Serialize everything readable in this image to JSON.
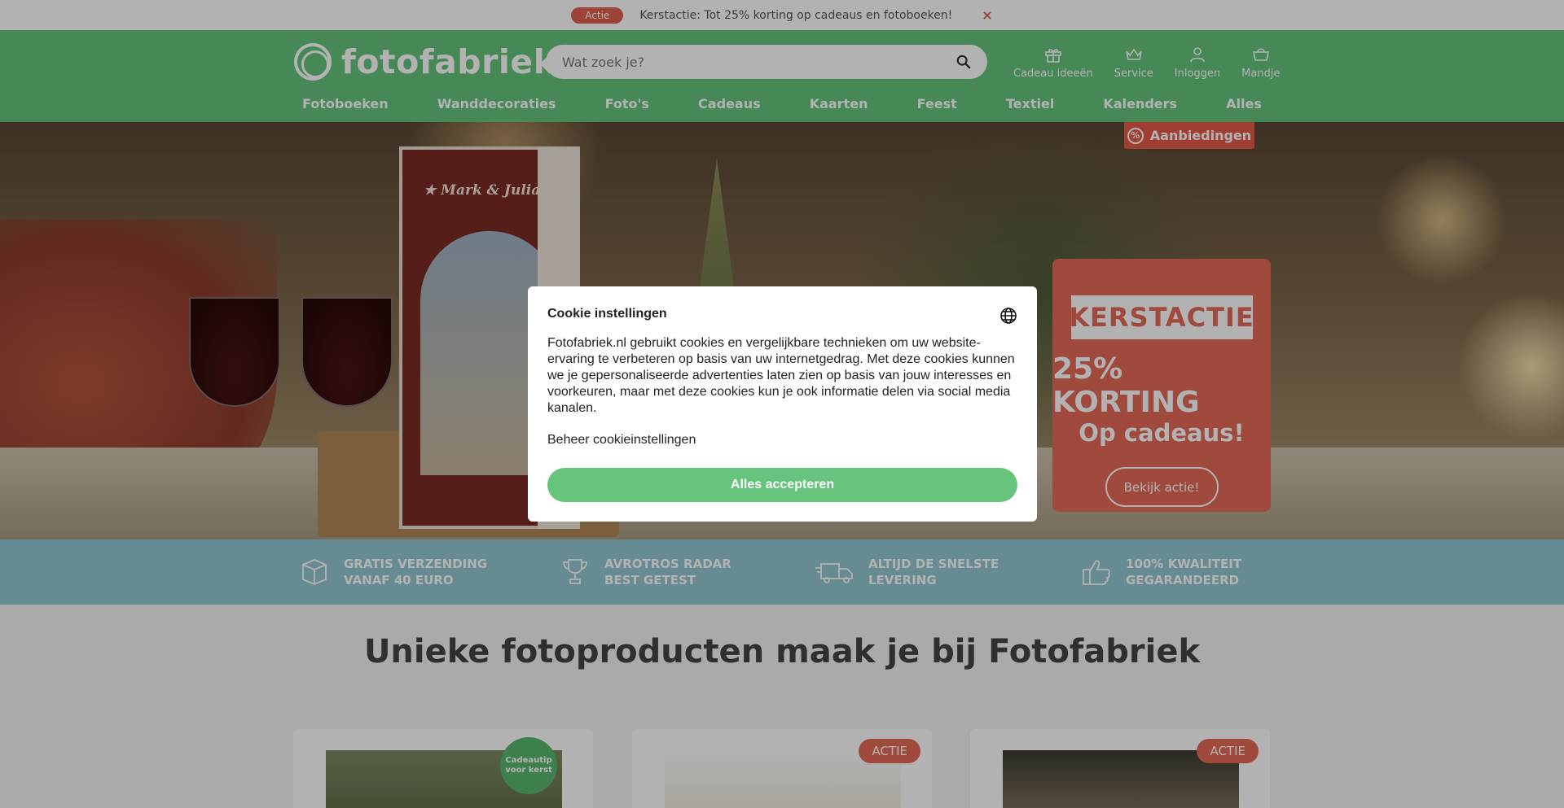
{
  "topbar": {
    "badge": "Actie",
    "message": "Kerstactie: Tot 25% korting op cadeaus en fotoboeken!",
    "close": "×"
  },
  "header": {
    "logo_text": "fotofabriek",
    "search": {
      "placeholder": "Wat zoek je?"
    },
    "icons": [
      {
        "label": "Cadeau ideeën",
        "icon": "gift-icon"
      },
      {
        "label": "Service",
        "icon": "crown-icon"
      },
      {
        "label": "Inloggen",
        "icon": "user-icon"
      },
      {
        "label": "Mandje",
        "icon": "basket-icon"
      }
    ],
    "nav": [
      "Fotoboeken",
      "Wanddecoraties",
      "Foto's",
      "Cadeaus",
      "Kaarten",
      "Feest",
      "Textiel",
      "Kalenders",
      "Alles"
    ]
  },
  "hero": {
    "offers_tab": "Aanbiedingen",
    "box_title": "★ Mark & Julia ★",
    "promo": {
      "stamp": "KERSTACTIE",
      "headline": "25% KORTING",
      "sub": "Op cadeaus!",
      "button": "Bekijk actie!"
    }
  },
  "usp": [
    {
      "line1": "GRATIS VERZENDING",
      "line2": "VANAF 40 EURO",
      "icon": "package-icon"
    },
    {
      "line1": "AVROTROS RADAR",
      "line2": "BEST GETEST",
      "icon": "trophy-icon"
    },
    {
      "line1": "ALTIJD DE SNELSTE",
      "line2": "LEVERING",
      "icon": "truck-icon"
    },
    {
      "line1": "100% KWALITEIT",
      "line2": "GEGARANDEERD",
      "icon": "thumbs-up-icon"
    }
  ],
  "content": {
    "title": "Unieke fotoproducten maak je bij Fotofabriek",
    "cards": [
      {
        "badge": "Cadeautip voor kerst"
      },
      {
        "badge": "ACTIE"
      },
      {
        "badge": "ACTIE"
      }
    ]
  },
  "cookie": {
    "title": "Cookie instellingen",
    "body": "Fotofabriek.nl gebruikt cookies en vergelijkbare technieken om uw website-ervaring te verbeteren op basis van uw internetgedrag. Met deze cookies kunnen we je gepersonaliseerde advertenties laten zien op basis van jouw interesses en voorkeuren, maar met deze cookies kun je ook informatie delen via social media kanalen.",
    "manage": "Beheer cookieinstellingen",
    "accept": "Alles accepteren"
  },
  "colors": {
    "brand_green": "#66c47c",
    "accent_red": "#e56a58",
    "usp_blue": "#92c7d3"
  }
}
